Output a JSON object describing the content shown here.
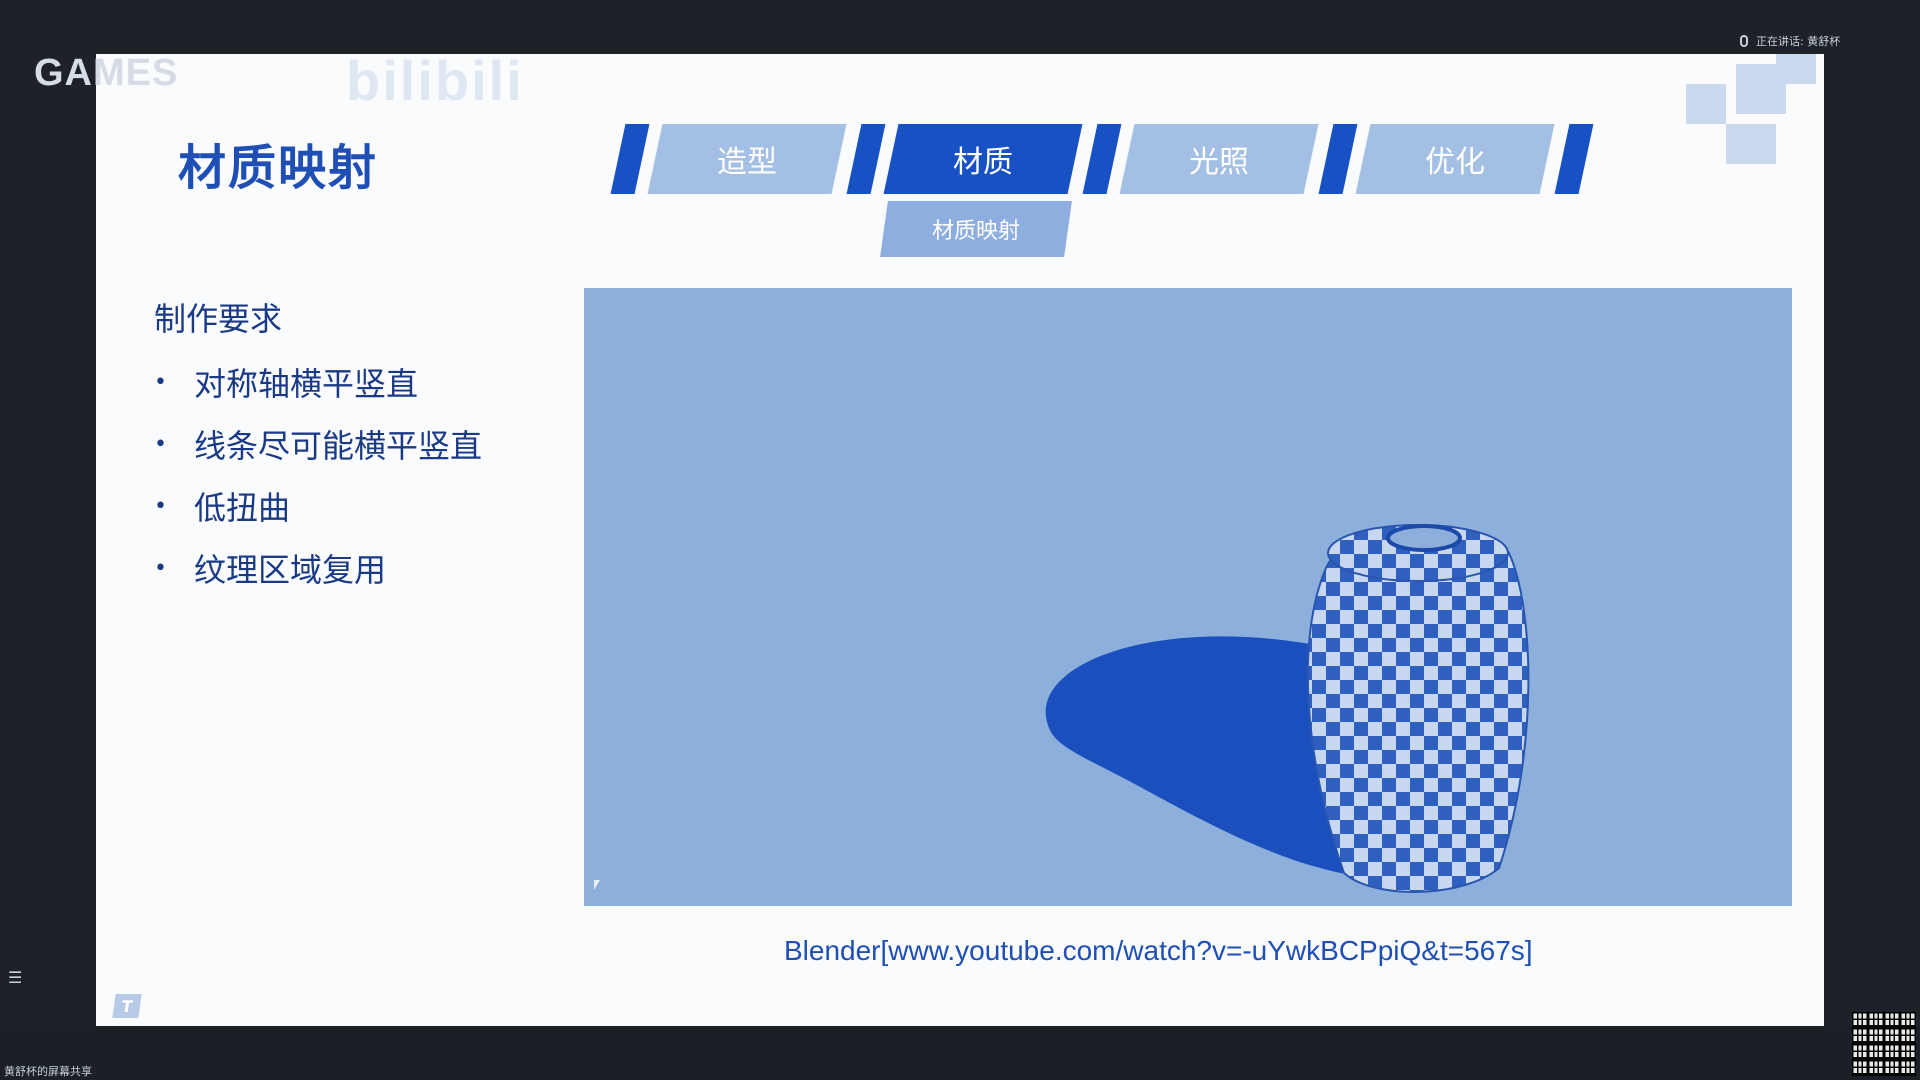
{
  "app": {
    "brand": "GAMES",
    "speaker_status": "正在讲话: 黄舒杯",
    "share_label": "黄舒杯的屏幕共享"
  },
  "slide": {
    "title": "材质映射",
    "watermark": "bilibili",
    "tabs": [
      {
        "label": "造型",
        "active": false
      },
      {
        "label": "材质",
        "active": true
      },
      {
        "label": "光照",
        "active": false
      },
      {
        "label": "优化",
        "active": false
      }
    ],
    "subtab": "材质映射",
    "requirements_heading": "制作要求",
    "requirements": [
      "对称轴横平竖直",
      "线条尽可能横平竖直",
      "低扭曲",
      "纹理区域复用"
    ],
    "bullet": "•",
    "caption": "Blender[www.youtube.com/watch?v=-uYwkBCPpiQ&t=567s]",
    "corner_logo": "T"
  },
  "colors": {
    "accent": "#1751c4",
    "tab_inactive": "#a3bfe3",
    "render_bg": "#8cafdb",
    "text": "#1a3a86"
  }
}
